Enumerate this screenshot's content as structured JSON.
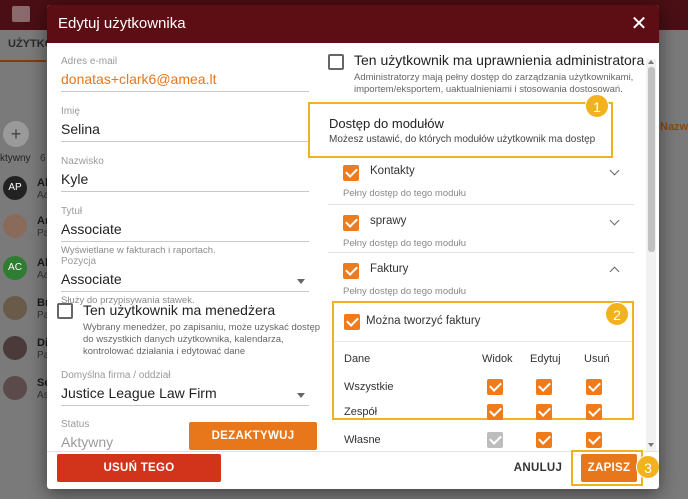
{
  "background": {
    "tab_label": "UŻYTKO",
    "plus": "+",
    "aktywny": "ktywny",
    "six": "6",
    "nazwa": "Nazwa",
    "rows": [
      {
        "initials": "AP",
        "a": "Al",
        "b": "Aa",
        "color": "#222222"
      },
      {
        "initials": "",
        "a": "Ar",
        "b": "Pa",
        "color": "#8a6a5a"
      },
      {
        "initials": "AC",
        "a": "Al",
        "b": "Aa",
        "color": "#2e7d32"
      },
      {
        "initials": "",
        "a": "Br",
        "b": "Pa",
        "color": "#6a5a4a"
      },
      {
        "initials": "",
        "a": "Di",
        "b": "Pa",
        "color": "#4a3a3a"
      },
      {
        "initials": "",
        "a": "Se",
        "b": "As",
        "color": "#5a4a4a"
      }
    ]
  },
  "modal": {
    "title": "Edytuj użytkownika",
    "close": "✕"
  },
  "form": {
    "email_label": "Adres e-mail",
    "email_value": "donatas+clark6@amea.lt",
    "first_name_label": "Imię",
    "first_name_value": "Selina",
    "last_name_label": "Nazwisko",
    "last_name_value": "Kyle",
    "title_label": "Tytuł",
    "title_value": "Associate",
    "title_hint": "Wyświetlane w fakturach i raportach.",
    "position_label": "Pozycja",
    "position_value": "Associate",
    "position_hint": "Służy do przypisywania stawek.",
    "manager_label": "Ten użytkownik ma menedżera",
    "manager_desc": "Wybrany menedżer, po zapisaniu, może uzyskać dostęp do wszystkich danych użytkownika, kalendarza, kontrolować działania i edytować dane",
    "firm_label": "Domyślna firma / oddział",
    "firm_value": "Justice League Law Firm",
    "status_label": "Status",
    "status_value": "Aktywny",
    "deactivate_label": "DEZAKTYWUJ"
  },
  "admin": {
    "label": "Ten użytkownik ma uprawnienia administratora",
    "desc": "Administratorzy mają pełny dostęp do zarządzania użytkownikami, importem/eksportem, uaktualnieniami i stosowania dostosowań."
  },
  "modules_access": {
    "title": "Dostęp do modułów",
    "desc": "Możesz ustawić, do których modułów użytkownik ma dostęp",
    "badge": "1"
  },
  "modules": [
    {
      "name": "Kontakty",
      "desc": "Pełny dostęp do tego modułu"
    },
    {
      "name": "sprawy",
      "desc": "Pełny dostęp do tego modułu"
    },
    {
      "name": "Faktury",
      "desc": "Pełny dostęp do tego modułu"
    }
  ],
  "invoice_create": {
    "label": "Można tworzyć faktury",
    "badge": "2"
  },
  "permissions": {
    "headers": [
      "Dane",
      "Widok",
      "Edytuj",
      "Usuń"
    ],
    "rows": [
      {
        "name": "Wszystkie"
      },
      {
        "name": "Zespół"
      },
      {
        "name": "Własne"
      }
    ]
  },
  "footer": {
    "delete_label": "USUŃ TEGO UŻYTKOWNIKA",
    "cancel_label": "ANULUJ",
    "save_label": "ZAPISZ",
    "badge": "3"
  },
  "colors": {
    "header": "#5c0e14",
    "accent": "#ef7b1b",
    "delete": "#d2331b",
    "callout": "#f2b21d"
  }
}
